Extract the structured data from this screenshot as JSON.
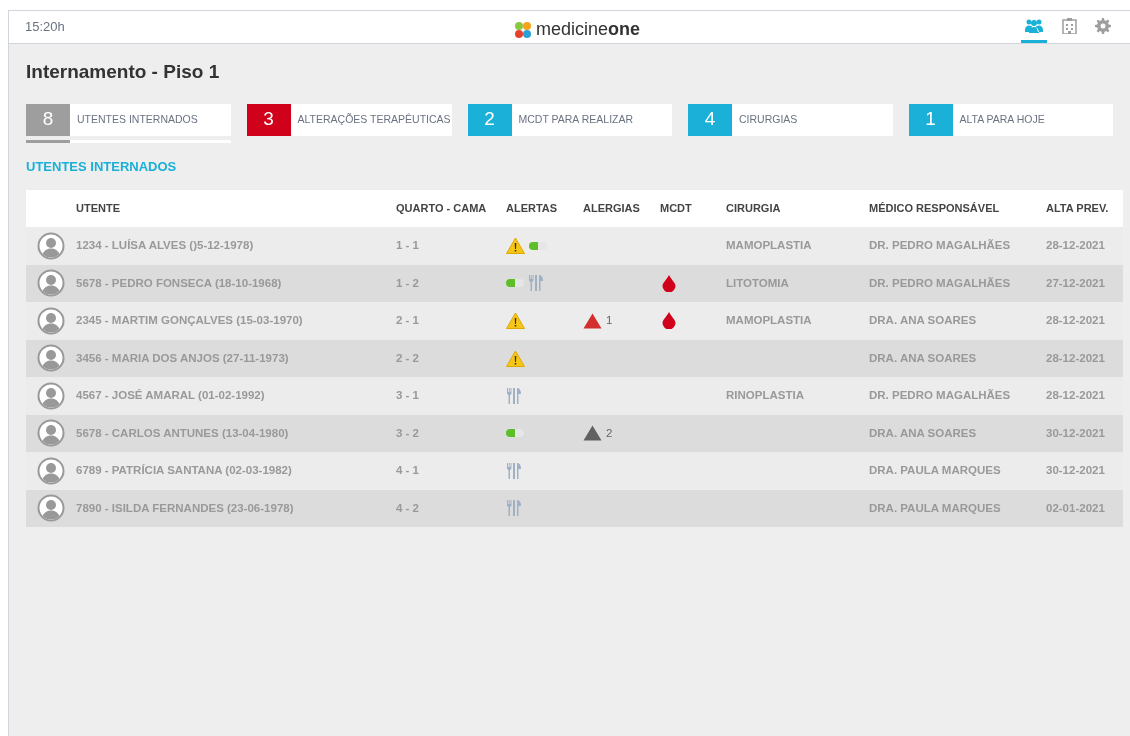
{
  "top_bar": {
    "time": "15:20h",
    "logo": "medicine**one**",
    "nav": [
      {
        "kind": "people",
        "selected": true
      },
      {
        "kind": "hospital",
        "selected": false
      },
      {
        "kind": "settings",
        "selected": false
      }
    ]
  },
  "page_title": "Internamento - Piso 1",
  "stats": [
    {
      "count": "8",
      "label": "UTENTES INTERNADOS",
      "color": "#9e9e9e",
      "selected": true
    },
    {
      "count": "3",
      "label": "ALTERAÇÕES TERAPÊUTICAS",
      "color": "#d0021b",
      "selected": false
    },
    {
      "count": "2",
      "label": "MCDT PARA REALIZAR",
      "color": "#1ab0d8",
      "selected": false
    },
    {
      "count": "4",
      "label": "CIRURGIAS",
      "color": "#1ab0d8",
      "selected": false
    },
    {
      "count": "1",
      "label": "ALTA PARA HOJE",
      "color": "#1ab0d8",
      "selected": false
    }
  ],
  "section_title": "UTENTES INTERNADOS",
  "table": {
    "columns": [
      "UTENTE",
      "QUARTO - CAMA",
      "ALERTAS",
      "ALERGIAS",
      "MCDT",
      "CIRURGIA",
      "MÉDICO RESPONSÁVEL",
      "ALTA PREV."
    ],
    "rows": [
      {
        "utente": "1234 - LUÍSA ALVES ()5-12-1978)",
        "quarto": "1 - 1",
        "alerts": [
          {
            "kind": "warning"
          },
          {
            "kind": "pill"
          }
        ],
        "cirurgia": "MAMOPLASTIA",
        "medico": "DR. PEDRO MAGALHÃES",
        "alta": "28-12-2021"
      },
      {
        "utente": "5678 - PEDRO FONSECA (18-10-1968)",
        "quarto": "1 - 2",
        "alerts": [
          {
            "kind": "pill"
          },
          {
            "kind": "cutlery"
          }
        ],
        "mcdt": {
          "kind": "blood"
        },
        "cirurgia": "LITOTOMIA",
        "medico": "DR. PEDRO MAGALHÃES",
        "alta": "27-12-2021"
      },
      {
        "utente": "2345 - MARTIM GONÇALVES (15-03-1970)",
        "quarto": "2 - 1",
        "alerts": [
          {
            "kind": "warning"
          }
        ],
        "allergy": {
          "count": "1",
          "color": "#d32f2f"
        },
        "mcdt": {
          "kind": "blood"
        },
        "cirurgia": "MAMOPLASTIA",
        "medico": "DRA. ANA SOARES",
        "alta": "28-12-2021"
      },
      {
        "utente": "3456 - MARIA DOS ANJOS (27-11-1973)",
        "quarto": "2 - 2",
        "alerts": [
          {
            "kind": "warning"
          }
        ],
        "medico": "DRA. ANA SOARES",
        "alta": "28-12-2021"
      },
      {
        "utente": "4567 - JOSÉ AMARAL (01-02-1992)",
        "quarto": "3 - 1",
        "alerts": [
          {
            "kind": "cutlery"
          }
        ],
        "cirurgia": "RINOPLASTIA",
        "medico": "DR. PEDRO MAGALHÃES",
        "alta": "28-12-2021"
      },
      {
        "utente": "5678 - CARLOS ANTUNES (13-04-1980)",
        "quarto": "3 - 2",
        "alerts": [
          {
            "kind": "pill"
          }
        ],
        "allergy": {
          "count": "2",
          "color": "#616161"
        },
        "medico": "DRA. ANA SOARES",
        "alta": "30-12-2021"
      },
      {
        "utente": "6789 - PATRÍCIA SANTANA (02-03-1982)",
        "quarto": "4 - 1",
        "alerts": [
          {
            "kind": "cutlery"
          }
        ],
        "medico": "DRA. PAULA MARQUES",
        "alta": "30-12-2021"
      },
      {
        "utente": "7890 - ISILDA FERNANDES (23-06-1978)",
        "quarto": "4 - 2",
        "alerts": [
          {
            "kind": "cutlery"
          }
        ],
        "medico": "DRA. PAULA MARQUES",
        "alta": "02-01-2021"
      }
    ]
  }
}
